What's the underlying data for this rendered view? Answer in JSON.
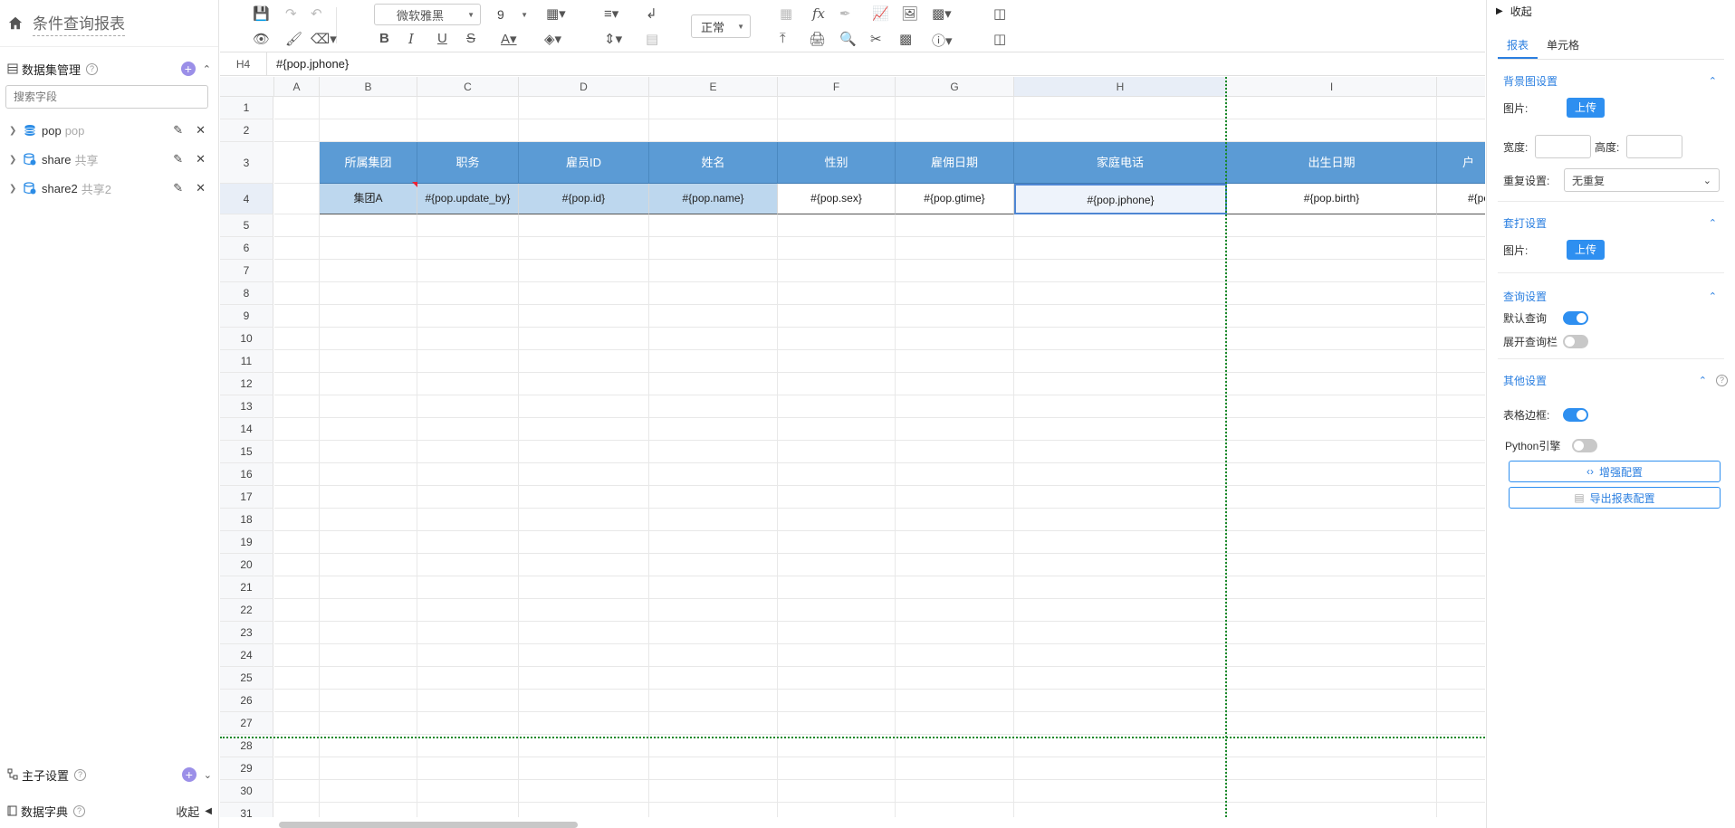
{
  "app": {
    "title": "条件查询报表"
  },
  "sidebar": {
    "dataset_title": "数据集管理",
    "search_placeholder": "搜索字段",
    "datasets": [
      {
        "name": "pop",
        "alias": "pop",
        "icon": "database-icon"
      },
      {
        "name": "share",
        "alias": "共享",
        "icon": "share-db-icon"
      },
      {
        "name": "share2",
        "alias": "共享2",
        "icon": "share-db-icon"
      }
    ],
    "main_sub_title": "主子设置",
    "dict_title": "数据字典",
    "collapse_label": "收起"
  },
  "toolbar": {
    "font_family": "微软雅黑",
    "font_size": "9",
    "zoom": "正常"
  },
  "formula_bar": {
    "cell_ref": "H4",
    "formula": "#{pop.jphone}"
  },
  "grid": {
    "columns": [
      "A",
      "B",
      "C",
      "D",
      "E",
      "F",
      "G",
      "H",
      "I"
    ],
    "selected_column": "H",
    "row_numbers": [
      "1",
      "2",
      "3",
      "4",
      "5",
      "6",
      "7",
      "8",
      "9",
      "10",
      "11",
      "12",
      "13",
      "14",
      "15",
      "16",
      "17",
      "18",
      "19",
      "20",
      "21",
      "22",
      "23",
      "24",
      "25",
      "26",
      "27",
      "28",
      "29",
      "30",
      "31"
    ],
    "selected_row": "4",
    "header_row": [
      "所属集团",
      "职务",
      "雇员ID",
      "姓名",
      "性别",
      "雇佣日期",
      "家庭电话",
      "出生日期",
      "户"
    ],
    "data_row": [
      "集团A",
      "#{pop.update_by}",
      "#{pop.id}",
      "#{pop.name}",
      "#{pop.sex}",
      "#{pop.gtime}",
      "#{pop.jphone}",
      "#{pop.birth}",
      "#{po"
    ],
    "accent": "#5b9bd5",
    "data_fill": "#bdd7ee"
  },
  "panel": {
    "collapse_label": "收起",
    "tabs": [
      "报表",
      "单元格"
    ],
    "active_tab": "报表",
    "bg_section": "背景图设置",
    "image_label": "图片:",
    "upload_label": "上传",
    "width_label": "宽度:",
    "height_label": "高度:",
    "repeat_label": "重复设置:",
    "repeat_value": "无重复",
    "overlay_section": "套打设置",
    "query_section": "查询设置",
    "default_query_label": "默认查询",
    "default_query_on": true,
    "expand_query_label": "展开查询栏",
    "expand_query_on": false,
    "other_section": "其他设置",
    "table_border_label": "表格边框:",
    "table_border_on": true,
    "python_label": "Python引擎",
    "python_on": false,
    "enhance_btn": "增强配置",
    "export_btn": "导出报表配置"
  }
}
